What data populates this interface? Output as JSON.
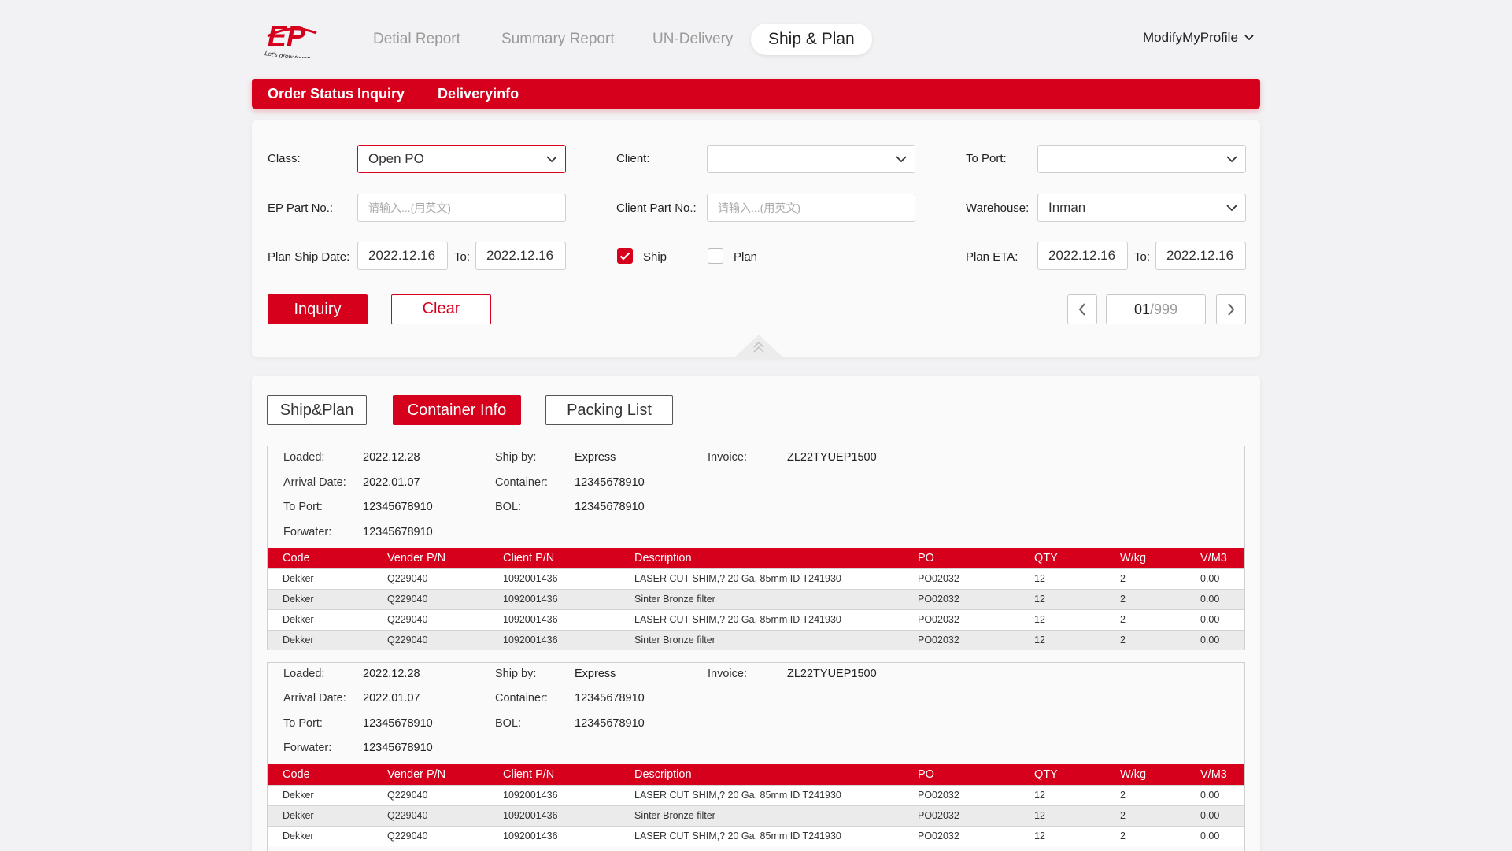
{
  "brand": {
    "logo_text": "EP",
    "tagline": "Let's grow together",
    "accent": "#d6001c"
  },
  "nav": {
    "tabs": [
      {
        "label": "Detial Report"
      },
      {
        "label": "Summary Report"
      },
      {
        "label": "UN-Delivery"
      },
      {
        "label": "Ship & Plan"
      }
    ],
    "active_tab": "Ship & Plan",
    "profile": "ModifyMyProfile"
  },
  "subnav": {
    "items": [
      "Order Status Inquiry",
      "Deliveryinfo"
    ]
  },
  "filter": {
    "class_label": "Class:",
    "class_value": "Open PO",
    "client_label": "Client:",
    "client_value": "",
    "to_port_label": "To Port:",
    "to_port_value": "",
    "ep_part_label": "EP Part No.:",
    "ep_part_placeholder": "请输入...(用英文)",
    "client_part_label": "Client Part No.:",
    "client_part_placeholder": "请输入...(用英文)",
    "warehouse_label": "Warehouse:",
    "warehouse_value": "Inman",
    "plan_ship_label": "Plan Ship Date:",
    "plan_ship_from": "2022.12.16",
    "to_label": "To:",
    "plan_ship_to": "2022.12.16",
    "ship_label": "Ship",
    "ship_checked": true,
    "plan_label": "Plan",
    "plan_checked": false,
    "plan_eta_label": "Plan ETA:",
    "plan_eta_from": "2022.12.16",
    "plan_eta_to": "2022.12.16",
    "inquiry_label": "Inquiry",
    "clear_label": "Clear",
    "page_current": "01",
    "page_total": "/999"
  },
  "content_tabs": {
    "items": [
      "Ship&Plan",
      "Container Info",
      "Packing List"
    ],
    "active": "Container Info"
  },
  "labels": {
    "loaded": "Loaded:",
    "arrival": "Arrival Date:",
    "to_port": "To Port:",
    "forwater": "Forwater:",
    "ship_by": "Ship by:",
    "container": "Container:",
    "bol": "BOL:",
    "invoice": "Invoice:"
  },
  "table_headers": [
    "Code",
    "Vender P/N",
    "Client P/N",
    "Description",
    "PO",
    "QTY",
    "W/kg",
    "V/M3"
  ],
  "containers": [
    {
      "loaded": "2022.12.28",
      "arrival": "2022.01.07",
      "to_port": "12345678910",
      "forwater": "12345678910",
      "ship_by": "Express",
      "container": "12345678910",
      "bol": "12345678910",
      "invoice": "ZL22TYUEP1500",
      "rows": [
        [
          "Dekker",
          "Q229040",
          "1092001436",
          "LASER CUT SHIM,? 20 Ga. 85mm ID T241930",
          "PO02032",
          "12",
          "2",
          "0.00"
        ],
        [
          "Dekker",
          "Q229040",
          "1092001436",
          "Sinter Bronze filter",
          "PO02032",
          "12",
          "2",
          "0.00"
        ],
        [
          "Dekker",
          "Q229040",
          "1092001436",
          "LASER CUT SHIM,? 20 Ga. 85mm ID T241930",
          "PO02032",
          "12",
          "2",
          "0.00"
        ],
        [
          "Dekker",
          "Q229040",
          "1092001436",
          "Sinter Bronze filter",
          "PO02032",
          "12",
          "2",
          "0.00"
        ]
      ]
    },
    {
      "loaded": "2022.12.28",
      "arrival": "2022.01.07",
      "to_port": "12345678910",
      "forwater": "12345678910",
      "ship_by": "Express",
      "container": "12345678910",
      "bol": "12345678910",
      "invoice": "ZL22TYUEP1500",
      "rows": [
        [
          "Dekker",
          "Q229040",
          "1092001436",
          "LASER CUT SHIM,? 20 Ga. 85mm ID T241930",
          "PO02032",
          "12",
          "2",
          "0.00"
        ],
        [
          "Dekker",
          "Q229040",
          "1092001436",
          "Sinter Bronze filter",
          "PO02032",
          "12",
          "2",
          "0.00"
        ],
        [
          "Dekker",
          "Q229040",
          "1092001436",
          "LASER CUT SHIM,? 20 Ga. 85mm ID T241930",
          "PO02032",
          "12",
          "2",
          "0.00"
        ]
      ]
    }
  ]
}
